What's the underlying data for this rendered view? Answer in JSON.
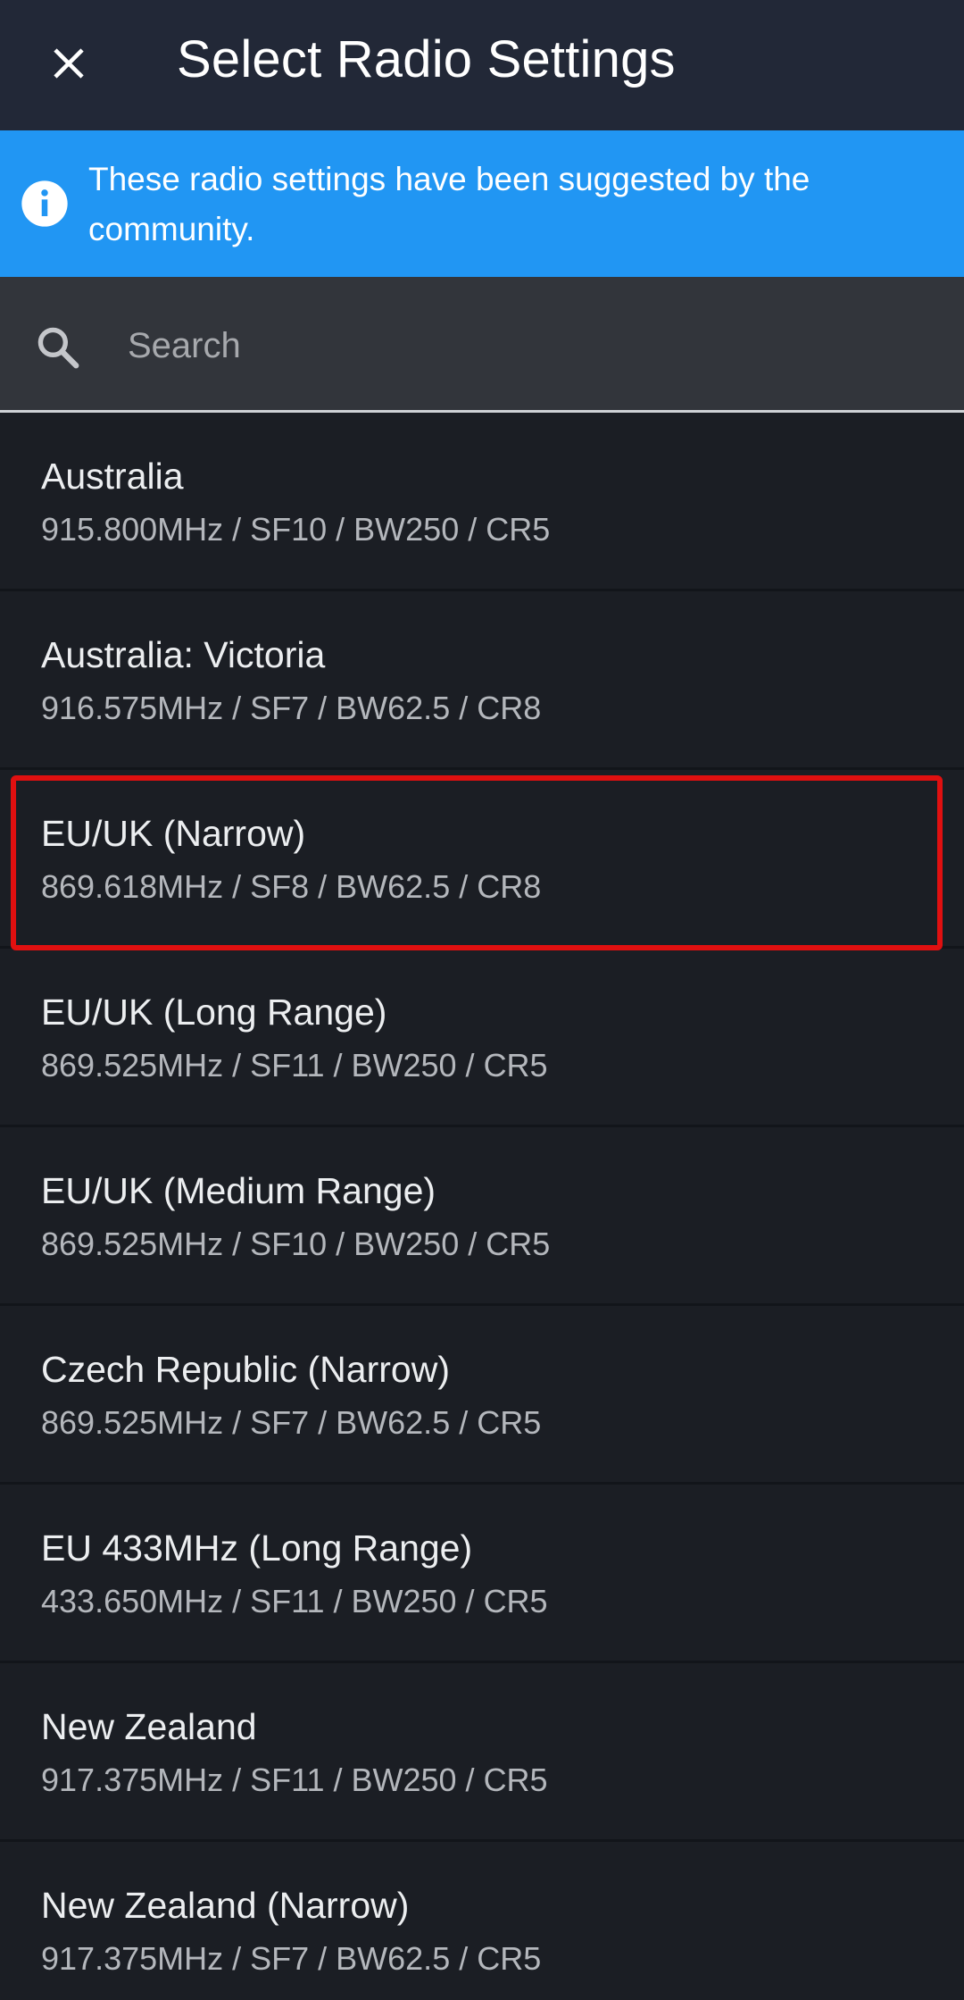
{
  "header": {
    "title": "Select Radio Settings",
    "close_icon": "close-icon"
  },
  "banner": {
    "icon": "info-icon",
    "text": "These radio settings have been suggested by the community.",
    "color": "#2196f3"
  },
  "search": {
    "placeholder": "Search",
    "value": ""
  },
  "presets": [
    {
      "name": "Australia",
      "details": "915.800MHz / SF10 / BW250 / CR5"
    },
    {
      "name": "Australia: Victoria",
      "details": "916.575MHz / SF7 / BW62.5 / CR8"
    },
    {
      "name": "EU/UK (Narrow)",
      "details": "869.618MHz / SF8 / BW62.5 / CR8",
      "highlighted": true
    },
    {
      "name": "EU/UK (Long Range)",
      "details": "869.525MHz / SF11 / BW250 / CR5"
    },
    {
      "name": "EU/UK (Medium Range)",
      "details": "869.525MHz / SF10 / BW250 / CR5"
    },
    {
      "name": "Czech Republic (Narrow)",
      "details": "869.525MHz / SF7 / BW62.5 / CR5"
    },
    {
      "name": "EU 433MHz (Long Range)",
      "details": "433.650MHz / SF11 / BW250 / CR5"
    },
    {
      "name": "New Zealand",
      "details": "917.375MHz / SF11 / BW250 / CR5"
    },
    {
      "name": "New Zealand (Narrow)",
      "details": "917.375MHz / SF7 / BW62.5 / CR5"
    }
  ]
}
